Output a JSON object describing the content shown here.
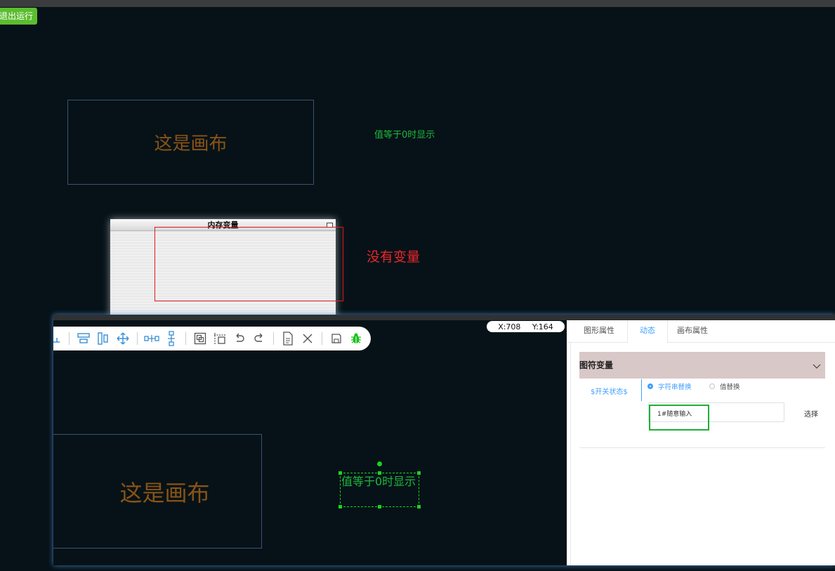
{
  "app": {
    "exit_button": "退出运行"
  },
  "canvas_top": {
    "box_text": "这是画布",
    "green_text": "值等于0时显示"
  },
  "memory_window": {
    "title": "内存变量",
    "annotation": "没有变量"
  },
  "editor": {
    "coords": {
      "x": "X:708",
      "y": "Y:164"
    },
    "toolbar_icons": [
      "align-icon",
      "distribute-h-icon",
      "distribute-v-icon",
      "move-icon",
      "h-connector-icon",
      "v-connector-icon",
      "group-icon",
      "ungroup-icon",
      "undo-icon",
      "redo-icon",
      "document-icon",
      "close-icon",
      "save-icon",
      "debug-bug-icon"
    ],
    "canvas_box_text": "这是画布",
    "selected_text": "值等于0时显示"
  },
  "panel": {
    "tabs": [
      "图形属性",
      "动态",
      "画布属性"
    ],
    "active_tab": "动态",
    "section_title": "图符变量",
    "variable_name": "$开关状态$",
    "radio_string": "字符串替换",
    "radio_value": "值替换",
    "input_value": "1#随意输入",
    "select_label": "选择"
  },
  "colors": {
    "background": "#061218",
    "canvas_text": "#8a5314",
    "green_text": "#1fb83c",
    "annotation_red": "#e8262b",
    "accent_blue": "#409eff"
  }
}
